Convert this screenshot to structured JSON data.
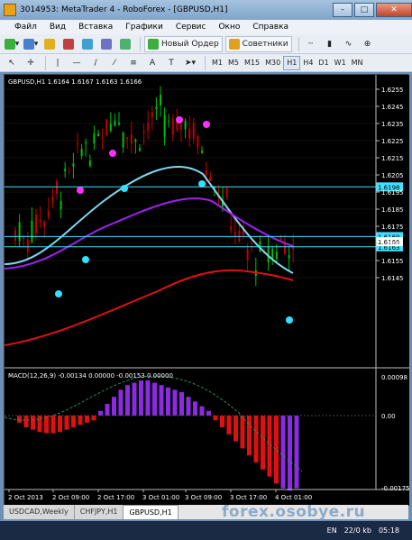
{
  "window": {
    "title": "3014953: MetaTrader 4 - RoboForex - [GBPUSD,H1]"
  },
  "menu": [
    "Файл",
    "Вид",
    "Вставка",
    "Графики",
    "Сервис",
    "Окно",
    "Справка"
  ],
  "toolbar": {
    "new_order": "Новый Ордер",
    "advisors": "Советники"
  },
  "timeframes": [
    "M1",
    "M5",
    "M15",
    "M30",
    "H1",
    "H4",
    "D1",
    "W1",
    "MN"
  ],
  "active_timeframe": "H1",
  "chart": {
    "header": "GBPUSD,H1  1.6164 1.6167 1.6163 1.6166",
    "price_ticks": [
      "1.6255",
      "1.6245",
      "1.6235",
      "1.6225",
      "1.6215",
      "1.6205",
      "1.6195",
      "1.6185",
      "1.6175",
      "1.6165",
      "1.6155",
      "1.6145"
    ],
    "price_levels": {
      "line1": "1.6198",
      "line2": "1.6169",
      "current": "1.6166",
      "line3": "1.6163"
    },
    "macd_header": "MACD(12,26,9)  -0.00134 0.00000 -0.00153 0.00000",
    "macd_ticks": [
      "0.00098",
      "0.00",
      "-0.00175"
    ],
    "time_labels": [
      "2 Oct 2013",
      "2 Oct 09:00",
      "2 Oct 17:00",
      "3 Oct 01:00",
      "3 Oct 09:00",
      "3 Oct 17:00",
      "4 Oct 01:00"
    ],
    "colors": {
      "bull": "#00c000",
      "bear": "#c00000",
      "ma_cyan": "#7fd8f0",
      "ma_violet": "#a020f0",
      "ma_red": "#e01010",
      "hline": "#40e0ff",
      "macd_pos": "#8a2be2",
      "macd_neg": "#e01010",
      "signal": "#2e8b57"
    }
  },
  "tabs": [
    "USDCAD,Weekly",
    "CHFJPY,H1",
    "GBPUSD,H1"
  ],
  "active_tab": "GBPUSD,H1",
  "watermark": "forex.osobye.ru",
  "status": {
    "lang": "EN",
    "traffic": "22/0 kb",
    "time": "05:18"
  }
}
